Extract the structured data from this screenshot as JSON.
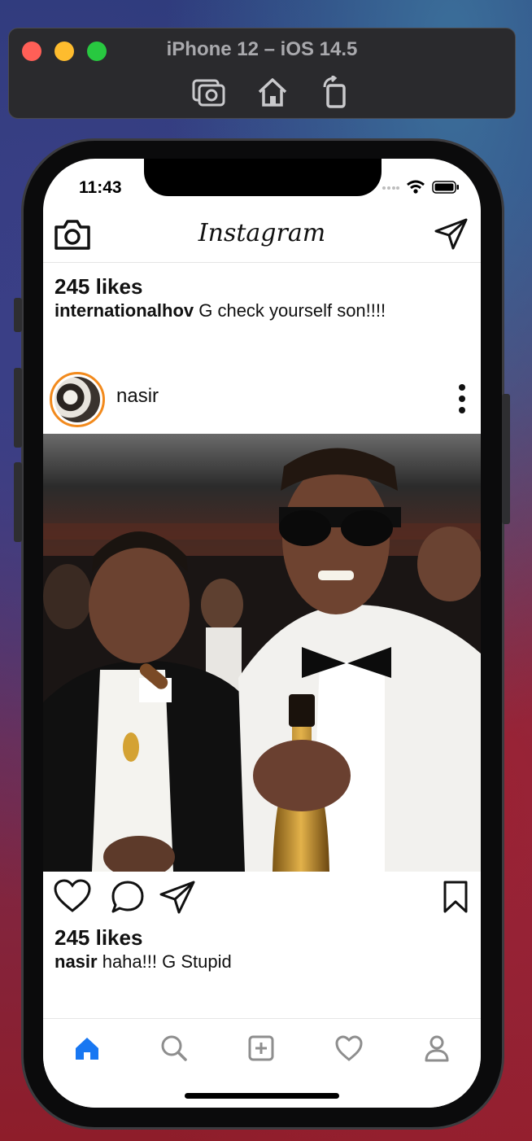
{
  "simulator": {
    "title": "iPhone 12 – iOS 14.5",
    "tools": [
      "screenshot-icon",
      "home-icon",
      "rotate-icon"
    ]
  },
  "status_bar": {
    "time": "11:43"
  },
  "top_bar": {
    "brand": "Instagram"
  },
  "previous_post": {
    "likes": "245 likes",
    "caption_user": "internationalhov",
    "caption_text": " G check yourself son!!!!"
  },
  "post": {
    "username": "nasir",
    "likes": "245 likes",
    "caption_user": "nasir",
    "caption_text": " haha!!! G Stupid"
  },
  "tab_bar": {
    "active": "home",
    "items": [
      "home-icon",
      "search-icon",
      "add-post-icon",
      "activity-heart-icon",
      "profile-icon"
    ]
  },
  "colors": {
    "accent": "#1877f2",
    "story_ring": "#f28a1d",
    "tab_inactive": "#8e8e8e"
  }
}
